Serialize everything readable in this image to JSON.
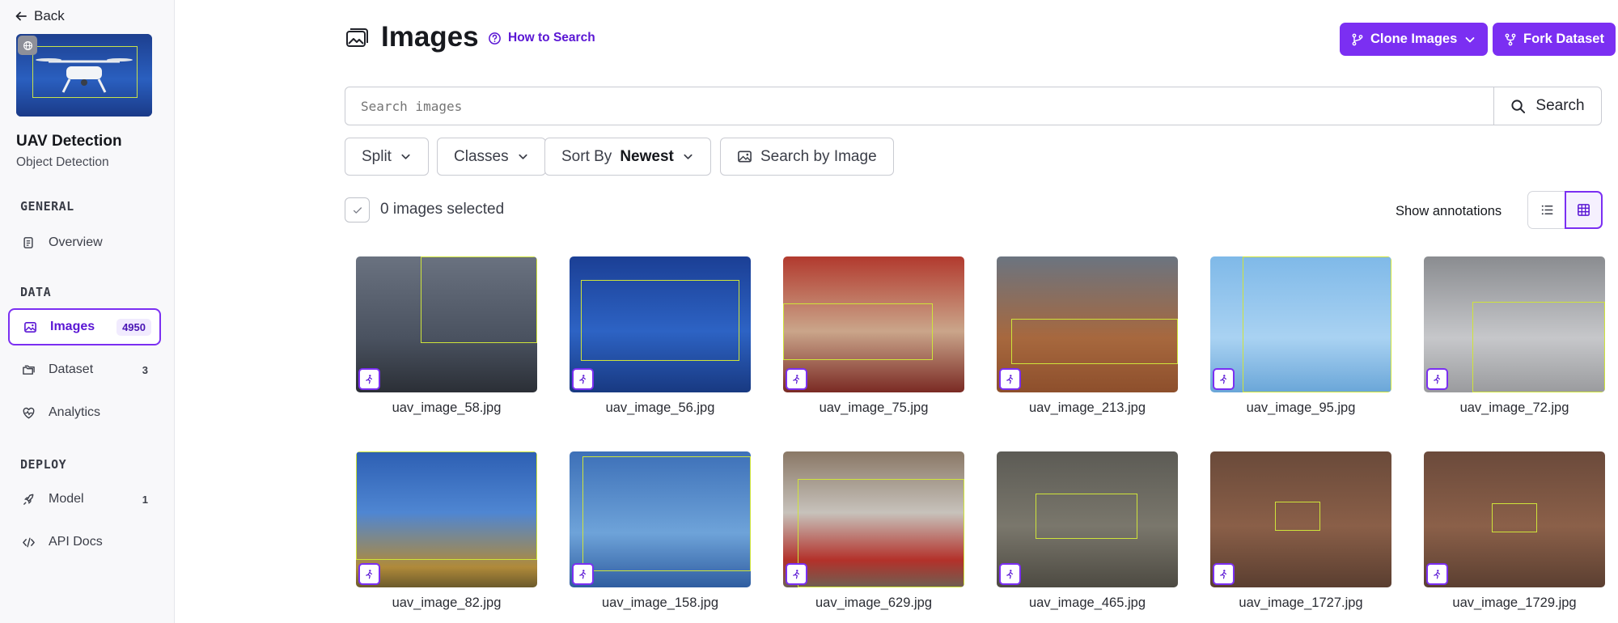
{
  "sidebar": {
    "back_label": "Back",
    "project_name": "UAV Detection",
    "project_type": "Object Detection",
    "sections": {
      "general": "GENERAL",
      "data": "DATA",
      "deploy": "DEPLOY"
    },
    "items": [
      {
        "label": "Overview",
        "count": "",
        "icon": "document-icon"
      },
      {
        "label": "Images",
        "count": "4950",
        "icon": "images-icon",
        "active": true
      },
      {
        "label": "Dataset",
        "count": "3",
        "icon": "folders-icon"
      },
      {
        "label": "Analytics",
        "count": "",
        "icon": "analytics-icon"
      },
      {
        "label": "Model",
        "count": "1",
        "icon": "rocket-icon"
      },
      {
        "label": "API Docs",
        "count": "",
        "icon": "code-icon"
      }
    ]
  },
  "header": {
    "title": "Images",
    "how_to_search": "How to Search",
    "clone_label": "Clone Images",
    "fork_label": "Fork Dataset"
  },
  "search": {
    "placeholder": "Search images",
    "button_label": "Search"
  },
  "filters": {
    "split": "Split",
    "classes": "Classes",
    "sort_by_label": "Sort By",
    "sort_by_value": "Newest",
    "search_by_image": "Search by Image"
  },
  "selection": {
    "text": "0 images selected",
    "show_annotations": "Show annotations"
  },
  "colors": {
    "accent": "#7b2ff2",
    "annotation_box": "#cfe43a"
  },
  "images": [
    {
      "name": "uav_image_58.jpg",
      "bg": "linear-gradient(180deg,#6a7280 0%,#4a5260 60%,#2b2f36 100%)"
    },
    {
      "name": "uav_image_56.jpg",
      "bg": "linear-gradient(180deg,#1b3f95 0%,#2d63c4 55%,#183981 100%)"
    },
    {
      "name": "uav_image_75.jpg",
      "bg": "linear-gradient(180deg,#b23a2e 0%,#caa58a 55%,#7a2a24 100%)"
    },
    {
      "name": "uav_image_213.jpg",
      "bg": "linear-gradient(180deg,#6b7480 0%,#a7683e 60%,#8d4f2c 100%)"
    },
    {
      "name": "uav_image_95.jpg",
      "bg": "linear-gradient(180deg,#7fb9e8 0%,#a9d2f2 60%,#6aa6d8 100%)"
    },
    {
      "name": "uav_image_72.jpg",
      "bg": "linear-gradient(180deg,#8a8c90 0%,#c6c7ca 60%,#9a9b9e 100%)"
    },
    {
      "name": "uav_image_82.jpg",
      "bg": "linear-gradient(180deg,#2d5fb3 0%,#4f86d2 45%,#b08a3a 85%,#6b5a2b 100%)"
    },
    {
      "name": "uav_image_158.jpg",
      "bg": "linear-gradient(180deg,#3d70b8 0%,#6ea3d9 60%,#2f5da0 100%)"
    },
    {
      "name": "uav_image_629.jpg",
      "bg": "linear-gradient(180deg,#8a7866 0%,#c7c2bb 45%,#b3312a 80%,#6e5f52 100%)"
    },
    {
      "name": "uav_image_465.jpg",
      "bg": "linear-gradient(180deg,#5c5b55 0%,#7a776c 55%,#4d4a42 100%)"
    },
    {
      "name": "uav_image_1727.jpg",
      "bg": "linear-gradient(180deg,#6a4a3a 0%,#8a5f48 55%,#5a3e30 100%)"
    },
    {
      "name": "uav_image_1729.jpg",
      "bg": "linear-gradient(180deg,#6b4a3b 0%,#8b6049 55%,#5b3f31 100%)"
    }
  ]
}
